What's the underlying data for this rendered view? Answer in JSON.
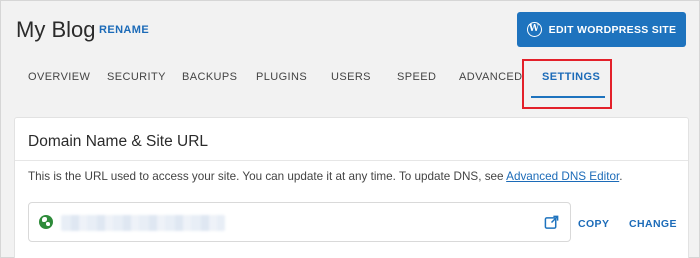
{
  "header": {
    "title": "My Blog",
    "rename_label": "RENAME",
    "edit_button_label": "EDIT WORDPRESS SITE",
    "edit_button_icon": "wordpress-icon"
  },
  "tabs": [
    {
      "label": "OVERVIEW",
      "active": false
    },
    {
      "label": "SECURITY",
      "active": false
    },
    {
      "label": "BACKUPS",
      "active": false
    },
    {
      "label": "PLUGINS",
      "active": false
    },
    {
      "label": "USERS",
      "active": false
    },
    {
      "label": "SPEED",
      "active": false
    },
    {
      "label": "ADVANCED",
      "active": false
    },
    {
      "label": "SETTINGS",
      "active": true
    }
  ],
  "card": {
    "title": "Domain Name & Site URL",
    "description": "This is the URL used to access your site. You can update it at any time. To update DNS, see ",
    "description_link": "Advanced DNS Editor",
    "description_end": ".",
    "url_field_icon": "globe-icon",
    "external_icon": "external-link-icon",
    "copy_label": "COPY",
    "change_label": "CHANGE"
  },
  "colors": {
    "accent": "#1e73be",
    "highlight": "#e3202a",
    "globe": "#2e8b3a"
  }
}
